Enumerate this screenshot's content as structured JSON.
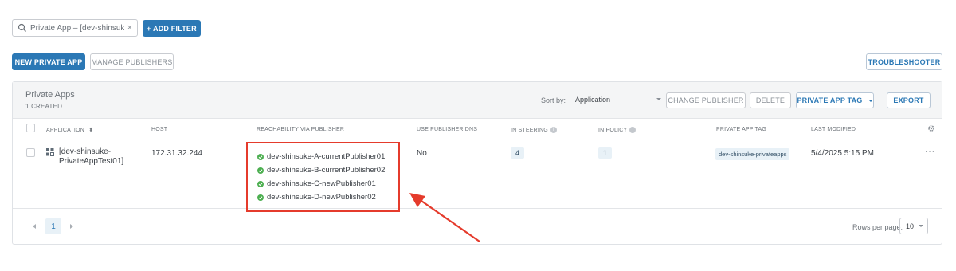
{
  "filter": {
    "chip_text": "Private App – [dev-shinsuke-P...",
    "clear": "×",
    "add_filter_label": "+ ADD FILTER"
  },
  "actions": {
    "new_private_app": "NEW PRIVATE APP",
    "manage_publishers": "MANAGE PUBLISHERS",
    "troubleshooter": "TROUBLESHOOTER"
  },
  "panel": {
    "title": "Private Apps",
    "subtitle": "1 CREATED",
    "sort_label": "Sort by:",
    "sort_value": "Application",
    "change_publisher": "CHANGE PUBLISHER",
    "delete": "DELETE",
    "private_app_tag": "PRIVATE APP TAG",
    "export": "EXPORT"
  },
  "table": {
    "columns": {
      "application": "APPLICATION",
      "host": "HOST",
      "reachability": "REACHABILITY VIA PUBLISHER",
      "use_dns": "USE PUBLISHER DNS",
      "in_steering": "IN STEERING",
      "in_policy": "IN POLICY",
      "tag": "PRIVATE APP TAG",
      "last_modified": "LAST MODIFIED"
    },
    "rows": [
      {
        "application_line1": "[dev-shinsuke-",
        "application_line2": "PrivateAppTest01]",
        "host": "172.31.32.244",
        "publishers": [
          "dev-shinsuke-A-currentPublisher01",
          "dev-shinsuke-B-currentPublisher02",
          "dev-shinsuke-C-newPublisher01",
          "dev-shinsuke-D-newPublisher02"
        ],
        "use_dns": "No",
        "in_steering": "4",
        "in_policy": "1",
        "tag": "dev-shinsuke-privateapps",
        "last_modified": "5/4/2025 5:15 PM",
        "more": "···"
      }
    ]
  },
  "pagination": {
    "current_page": "1",
    "rows_per_page_label": "Rows per page:",
    "rows_per_page": "10"
  },
  "colors": {
    "primary": "#2b78b5",
    "highlight_box": "#e53b2c",
    "success": "#4caf50"
  }
}
